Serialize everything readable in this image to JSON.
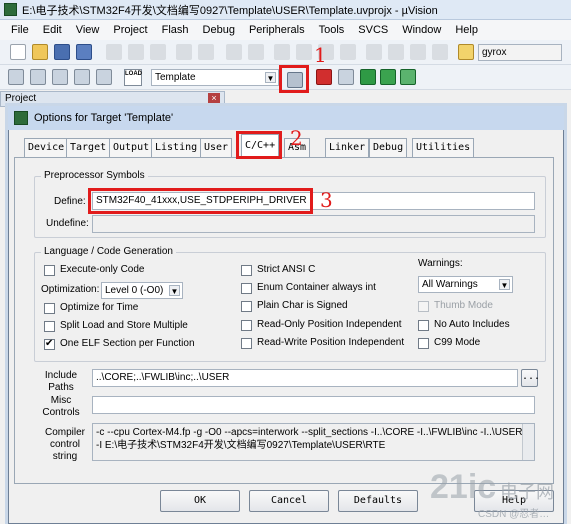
{
  "window": {
    "title": "E:\\电子技术\\STM32F4开发\\文档编写0927\\Template\\USER\\Template.uvprojx - µVision"
  },
  "menu": [
    "File",
    "Edit",
    "View",
    "Project",
    "Flash",
    "Debug",
    "Peripherals",
    "Tools",
    "SVCS",
    "Window",
    "Help"
  ],
  "toolbar": {
    "target_value": "Template",
    "search_value": "gyrox",
    "load_label": "LOAD"
  },
  "project_panel": {
    "title": "Project"
  },
  "dialog": {
    "title": "Options for Target 'Template'",
    "tabs": [
      "Device",
      "Target",
      "Output",
      "Listing",
      "User",
      "C/C++",
      "Asm",
      "Linker",
      "Debug",
      "Utilities"
    ],
    "active_tab": "C/C++",
    "preprocessor": {
      "group_title": "Preprocessor Symbols",
      "define_label": "Define:",
      "define_value": "STM32F40_41xxx,USE_STDPERIPH_DRIVER",
      "undefine_label": "Undefine:",
      "undefine_value": ""
    },
    "language": {
      "group_title": "Language / Code Generation",
      "execute_only": "Execute-only Code",
      "optimization_label": "Optimization:",
      "optimization_value": "Level 0 (-O0)",
      "optimize_time": "Optimize for Time",
      "split_load": "Split Load and Store Multiple",
      "one_elf": "One ELF Section per Function",
      "strict_ansi": "Strict ANSI C",
      "enum_container": "Enum Container always int",
      "plain_char": "Plain Char is Signed",
      "ro_independent": "Read-Only Position Independent",
      "rw_independent": "Read-Write Position Independent",
      "warnings_label": "Warnings:",
      "warnings_value": "All Warnings",
      "thumb_mode": "Thumb Mode",
      "no_auto_includes": "No Auto Includes",
      "c99_mode": "C99 Mode"
    },
    "include_paths_label": "Include\nPaths",
    "include_paths_value": "..\\CORE;..\\FWLIB\\inc;..\\USER",
    "browse_label": "...",
    "misc_controls_label": "Misc\nControls",
    "misc_controls_value": "",
    "compiler_label": "Compiler\ncontrol\nstring",
    "compiler_line1": "-c --cpu Cortex-M4.fp -g -O0 --apcs=interwork --split_sections -I..\\CORE -I..\\FWLIB\\inc -I..\\USER",
    "compiler_line2": "-I E:\\电子技术\\STM32F4开发\\文档编写0927\\Template\\USER\\RTE",
    "buttons": {
      "ok": "OK",
      "cancel": "Cancel",
      "defaults": "Defaults",
      "help": "Help"
    }
  },
  "annotations": [
    "1",
    "2",
    "3"
  ],
  "watermark": {
    "main": "电子网",
    "sub": "CSDN @忍者…"
  }
}
